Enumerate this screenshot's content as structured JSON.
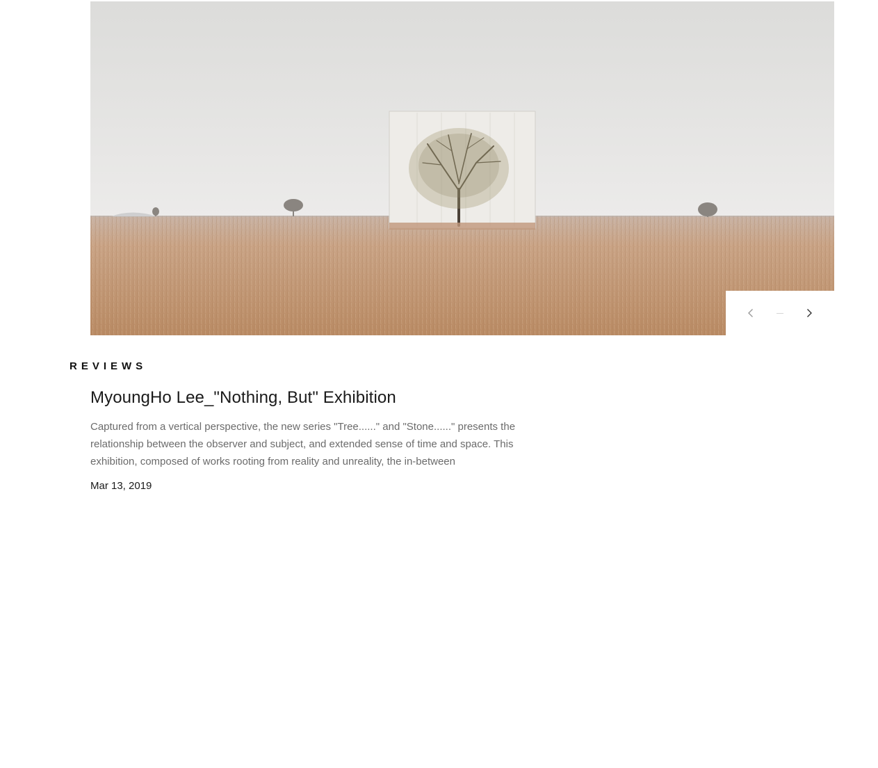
{
  "hero": {
    "image_name": "field-tree-canvas-photo",
    "colors": {
      "sky": "#e3e3e1",
      "field": "#c9a07d",
      "canvas": "#eceae6"
    }
  },
  "slider": {
    "prev_icon": "chevron-left-icon",
    "next_icon": "chevron-right-icon"
  },
  "section": {
    "label": "REVIEWS"
  },
  "article": {
    "title": "MyoungHo Lee_\"Nothing, But\" Exhibition",
    "excerpt": "Captured from a vertical perspective, the new series \"Tree......\" and \"Stone......\" presents the relationship between the observer and subject, and extended sense of time and space. This exhibition, composed of works rooting from reality and unreality, the in-between",
    "date": "Mar 13, 2019"
  }
}
